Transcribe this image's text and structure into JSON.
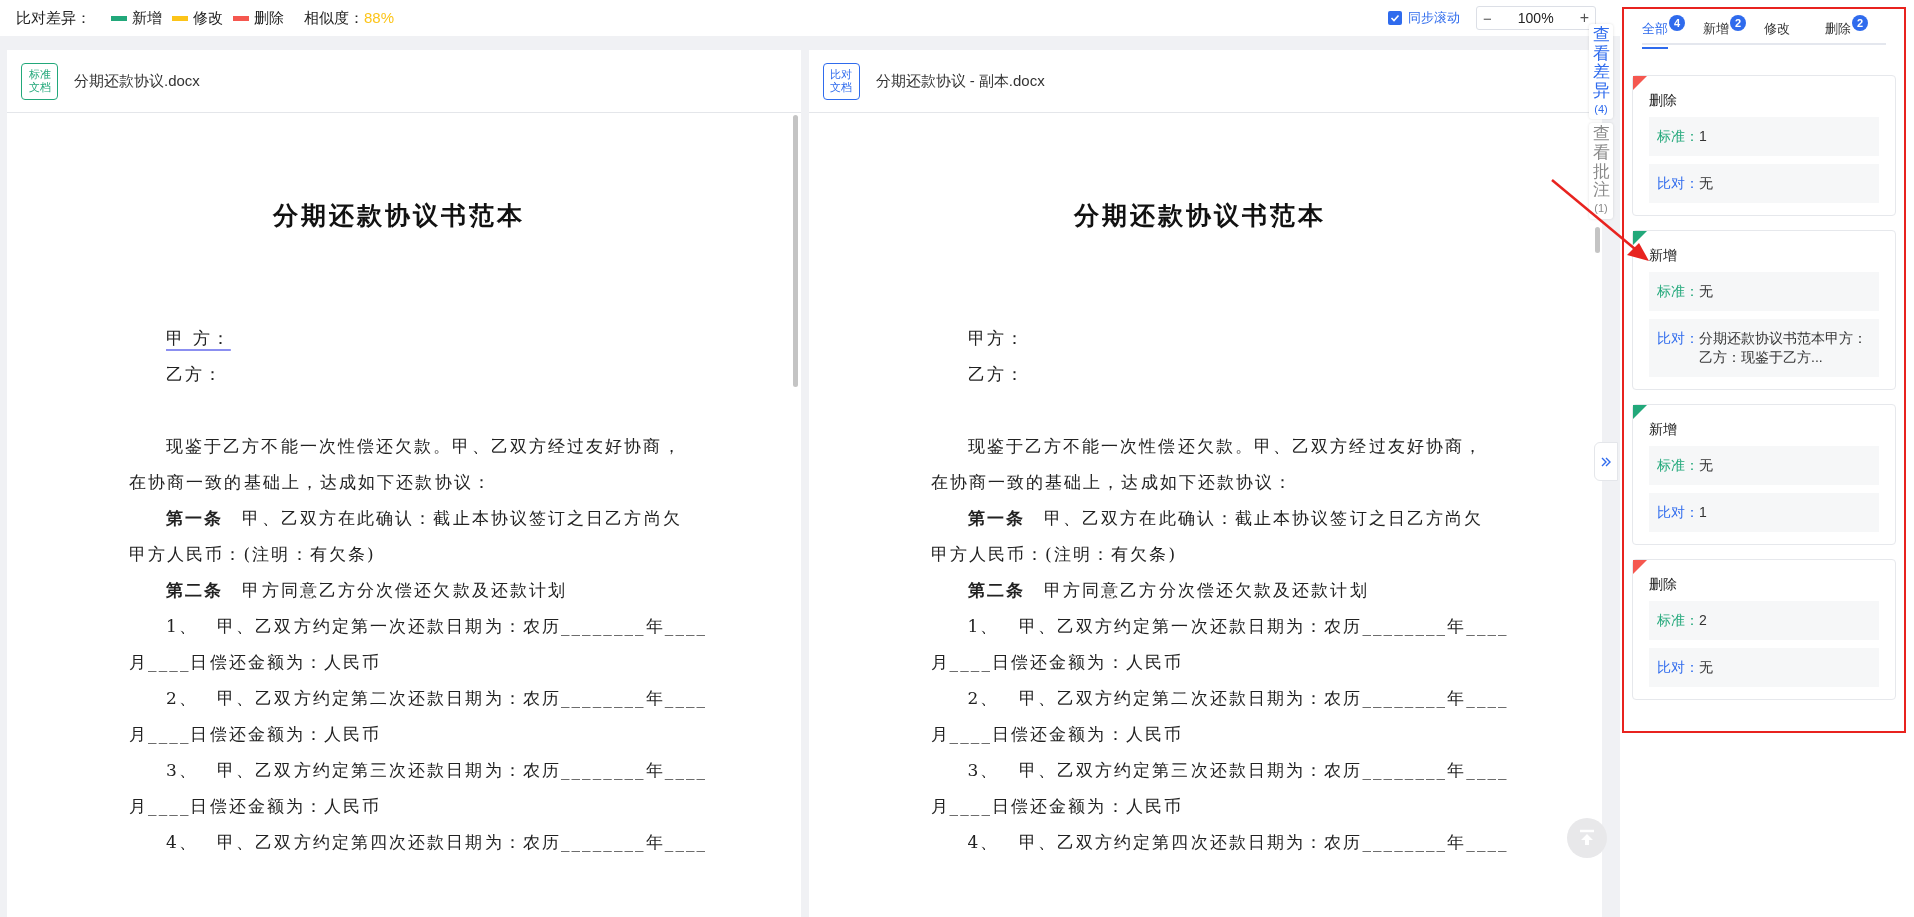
{
  "toolbar": {
    "legend_label": "比对差异：",
    "legend": [
      {
        "label": "新增",
        "color": "#22a87a"
      },
      {
        "label": "修改",
        "color": "#fcc419"
      },
      {
        "label": "删除",
        "color": "#f5574f"
      }
    ],
    "similarity_label": "相似度：",
    "similarity": "88%",
    "sync_scroll": {
      "label": "同步滚动",
      "checked": true
    },
    "zoom": {
      "minus": "−",
      "value": "100%",
      "plus": "+"
    }
  },
  "documents": [
    {
      "kind": "standard",
      "badge": [
        "标准",
        "文档"
      ],
      "filename": "分期还款协议.docx",
      "title": "分期还款协议书范本",
      "lines": [
        {
          "kind": "indent",
          "text": "甲 方：",
          "commented": true
        },
        {
          "kind": "indent",
          "text": "乙方：",
          "commented": false
        },
        {
          "kind": "blank"
        },
        {
          "kind": "indent",
          "text": "现鉴于乙方不能一次性偿还欠款。甲、乙双方经过友好协商，",
          "commented": false
        },
        {
          "kind": "line",
          "text": "在协商一致的基础上，达成如下还款协议：",
          "commented": false
        },
        {
          "kind": "indent",
          "text": "**第一条**　甲、乙双方在此确认：截止本协议签订之日乙方尚欠",
          "commented": false
        },
        {
          "kind": "line",
          "text": "甲方人民币：(注明：有欠条)",
          "commented": false
        },
        {
          "kind": "indent",
          "text": "**第二条**　甲方同意乙方分次偿还欠款及还款计划",
          "commented": false
        },
        {
          "kind": "indent",
          "text": "1、　甲、乙双方约定第一次还款日期为：农历________年____",
          "commented": false
        },
        {
          "kind": "line",
          "text": "月____日偿还金额为：人民币",
          "commented": false
        },
        {
          "kind": "indent",
          "text": "2、　甲、乙双方约定第二次还款日期为：农历________年____",
          "commented": false
        },
        {
          "kind": "line",
          "text": "月____日偿还金额为：人民币",
          "commented": false
        },
        {
          "kind": "indent",
          "text": "3、　甲、乙双方约定第三次还款日期为：农历________年____",
          "commented": false
        },
        {
          "kind": "line",
          "text": "月____日偿还金额为：人民币",
          "commented": false
        },
        {
          "kind": "indent",
          "text": "4、　甲、乙双方约定第四次还款日期为：农历________年____",
          "commented": false
        }
      ]
    },
    {
      "kind": "compare",
      "badge": [
        "比对",
        "文档"
      ],
      "filename": "分期还款协议 - 副本.docx",
      "title": "分期还款协议书范本",
      "lines": [
        {
          "kind": "indent",
          "text": "甲方：",
          "commented": false
        },
        {
          "kind": "indent",
          "text": "乙方：",
          "commented": false
        },
        {
          "kind": "blank"
        },
        {
          "kind": "indent",
          "text": "现鉴于乙方不能一次性偿还欠款。甲、乙双方经过友好协商，",
          "commented": false
        },
        {
          "kind": "line",
          "text": "在协商一致的基础上，达成如下还款协议：",
          "commented": false
        },
        {
          "kind": "indent",
          "text": "**第一条**　甲、乙双方在此确认：截止本协议签订之日乙方尚欠",
          "commented": false
        },
        {
          "kind": "line",
          "text": "甲方人民币：(注明：有欠条)",
          "commented": false
        },
        {
          "kind": "indent",
          "text": "**第二条**　甲方同意乙方分次偿还欠款及还款计划",
          "commented": false
        },
        {
          "kind": "indent",
          "text": "1、　甲、乙双方约定第一次还款日期为：农历________年____",
          "commented": false
        },
        {
          "kind": "line",
          "text": "月____日偿还金额为：人民币",
          "commented": false
        },
        {
          "kind": "indent",
          "text": "2、　甲、乙双方约定第二次还款日期为：农历________年____",
          "commented": false
        },
        {
          "kind": "line",
          "text": "月____日偿还金额为：人民币",
          "commented": false
        },
        {
          "kind": "indent",
          "text": "3、　甲、乙双方约定第三次还款日期为：农历________年____",
          "commented": false
        },
        {
          "kind": "line",
          "text": "月____日偿还金额为：人民币",
          "commented": false
        },
        {
          "kind": "indent",
          "text": "4、　甲、乙双方约定第四次还款日期为：农历________年____",
          "commented": false
        }
      ]
    }
  ],
  "side_tabs": [
    {
      "label": "查看差异",
      "count": "(4)",
      "selected": true
    },
    {
      "label": "查看批注",
      "count": "(1)",
      "selected": false
    }
  ],
  "diff_panel": {
    "tabs": [
      {
        "label": "全部",
        "count": "4",
        "selected": true
      },
      {
        "label": "新增",
        "count": "2",
        "selected": false
      },
      {
        "label": "修改",
        "selected": false
      },
      {
        "label": "删除",
        "count": "2",
        "selected": false
      }
    ],
    "items": [
      {
        "kind": "delete",
        "title": "删除",
        "rows": [
          {
            "kind": "standard",
            "label": "标准：",
            "value": "1"
          },
          {
            "kind": "compare",
            "label": "比对：",
            "value": "无"
          }
        ]
      },
      {
        "kind": "add",
        "title": "新增",
        "rows": [
          {
            "kind": "standard",
            "label": "标准：",
            "value": "无"
          },
          {
            "kind": "compare",
            "label": "比对：",
            "value": "分期还款协议书范本甲方：乙方：现鉴于乙方..."
          }
        ]
      },
      {
        "kind": "add",
        "title": "新增",
        "rows": [
          {
            "kind": "standard",
            "label": "标准：",
            "value": "无"
          },
          {
            "kind": "compare",
            "label": "比对：",
            "value": "1"
          }
        ]
      },
      {
        "kind": "delete",
        "title": "删除",
        "rows": [
          {
            "kind": "standard",
            "label": "标准：",
            "value": "2"
          },
          {
            "kind": "compare",
            "label": "比对：",
            "value": "无"
          }
        ]
      }
    ]
  }
}
